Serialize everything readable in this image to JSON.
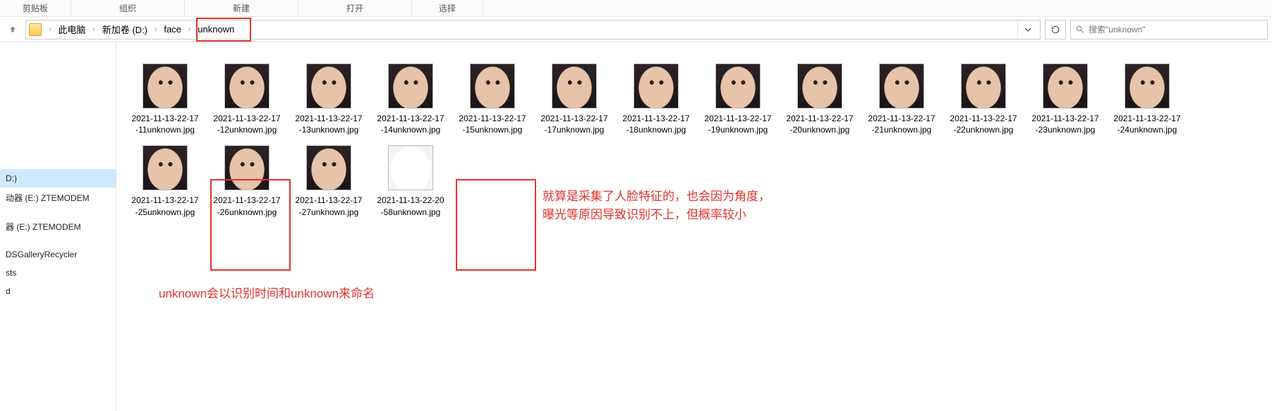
{
  "ribbon": {
    "tabs": [
      "剪贴板",
      "组织",
      "新建",
      "打开",
      "选择"
    ]
  },
  "breadcrumb": {
    "items": [
      "此电脑",
      "新加卷 (D:)",
      "face",
      "unknown"
    ]
  },
  "search": {
    "placeholder": "搜索\"unknown\""
  },
  "sidebar": {
    "items": [
      {
        "label": "D:)",
        "selected": true
      },
      {
        "label": "动器 (E:) ZTEMODEM",
        "selected": false
      },
      {
        "label": "",
        "selected": false
      },
      {
        "label": "器 (E:) ZTEMODEM",
        "selected": false
      },
      {
        "label": "",
        "selected": false
      },
      {
        "label": "DSGalleryRecycler",
        "selected": false
      },
      {
        "label": "sts",
        "selected": false
      },
      {
        "label": "d",
        "selected": false
      }
    ]
  },
  "files": [
    {
      "name": "2021-11-13-22-17-11unknown.jpg",
      "bright": false
    },
    {
      "name": "2021-11-13-22-17-12unknown.jpg",
      "bright": false
    },
    {
      "name": "2021-11-13-22-17-13unknown.jpg",
      "bright": false
    },
    {
      "name": "2021-11-13-22-17-14unknown.jpg",
      "bright": false
    },
    {
      "name": "2021-11-13-22-17-15unknown.jpg",
      "bright": false
    },
    {
      "name": "2021-11-13-22-17-17unknown.jpg",
      "bright": false
    },
    {
      "name": "2021-11-13-22-17-18unknown.jpg",
      "bright": false
    },
    {
      "name": "2021-11-13-22-17-19unknown.jpg",
      "bright": false
    },
    {
      "name": "2021-11-13-22-17-20unknown.jpg",
      "bright": false
    },
    {
      "name": "2021-11-13-22-17-21unknown.jpg",
      "bright": false
    },
    {
      "name": "2021-11-13-22-17-22unknown.jpg",
      "bright": false
    },
    {
      "name": "2021-11-13-22-17-23unknown.jpg",
      "bright": false
    },
    {
      "name": "2021-11-13-22-17-24unknown.jpg",
      "bright": false
    },
    {
      "name": "2021-11-13-22-17-25unknown.jpg",
      "bright": false
    },
    {
      "name": "2021-11-13-22-17-26unknown.jpg",
      "bright": false
    },
    {
      "name": "2021-11-13-22-17-27unknown.jpg",
      "bright": false
    },
    {
      "name": "2021-11-13-22-20-58unknown.jpg",
      "bright": true
    }
  ],
  "annotations": {
    "bottom": "unknown会以识别时间和unknown来命名",
    "right1": "就算是采集了人脸特征的，也会因为角度，",
    "right2": "曝光等原因导致识别不上，但概率较小"
  }
}
